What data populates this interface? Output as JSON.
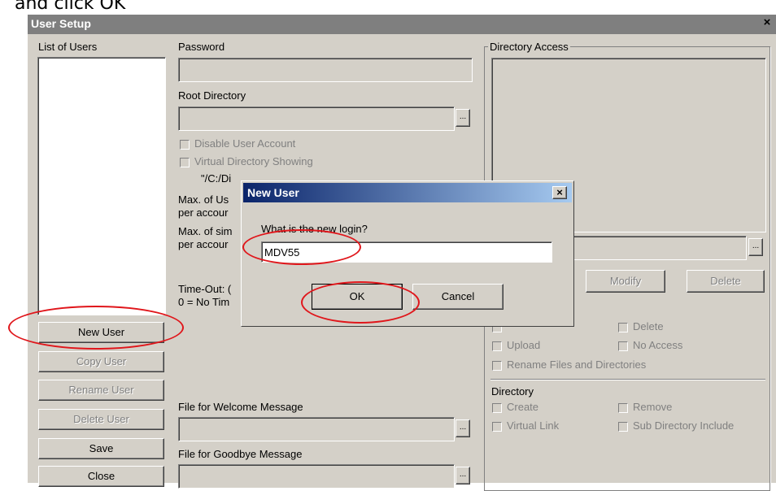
{
  "caption": "and click OK",
  "window": {
    "title": "User Setup",
    "close_glyph": "×"
  },
  "left": {
    "list_label": "List of Users",
    "buttons": {
      "new_user": "New User",
      "copy_user": "Copy User",
      "rename_user": "Rename User",
      "delete_user": "Delete User",
      "save": "Save",
      "close": "Close"
    }
  },
  "middle": {
    "password_label": "Password",
    "root_dir_label": "Root Directory",
    "browse_glyph": "...",
    "disable_account": "Disable User Account",
    "virtual_dir_showing": "Virtual Directory Showing",
    "virtual_path": "\"/C:/Di",
    "max_users_1": "Max. of Us",
    "per_account_1": "per accour",
    "max_sim_1": "Max. of sim",
    "per_account_2": "per accour",
    "timeout": "Time-Out: (",
    "no_time": "0 = No Tim",
    "welcome_label": "File for Welcome Message",
    "goodbye_label": "File for Goodbye Message"
  },
  "right": {
    "dir_access_label": "Directory Access",
    "modify": "Modify",
    "delete_btn": "Delete",
    "file_perms": {
      "delete": "Delete",
      "upload": "Upload",
      "no_access": "No Access",
      "rename": "Rename Files and Directories"
    },
    "directory_label": "Directory",
    "dir_perms": {
      "create": "Create",
      "remove": "Remove",
      "virtual_link": "Virtual Link",
      "sub_dir": "Sub Directory Include"
    }
  },
  "dialog": {
    "title": "New User",
    "close_glyph": "×",
    "prompt": "What is the new login?",
    "login_value": "MDV55",
    "ok": "OK",
    "cancel": "Cancel"
  },
  "colors": {
    "highlight": "#e0161b",
    "dialog_title": "#0a246a",
    "window_bg": "#d4d0c8"
  },
  "icons": {
    "checkbox": "checkbox-icon",
    "close": "close-icon",
    "browse": "ellipsis-icon"
  }
}
